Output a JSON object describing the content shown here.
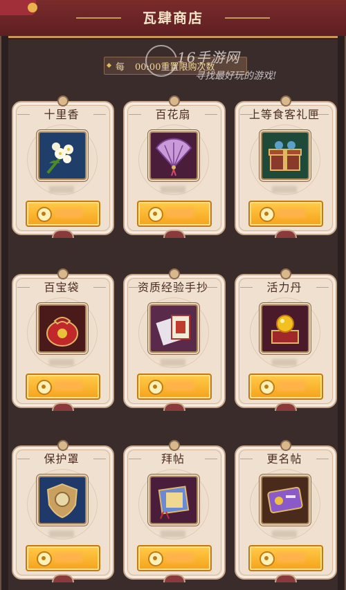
{
  "shop": {
    "title": "瓦肆商店",
    "notice_prefix": "每",
    "notice_time": "00:00重置限购次数"
  },
  "watermark": {
    "line1": "16手游网",
    "line2": "寻找最好玩的游戏!"
  },
  "items": [
    {
      "name": "十里香",
      "icon": "jasmine-flower-icon"
    },
    {
      "name": "百花扇",
      "icon": "flower-fan-icon"
    },
    {
      "name": "上等食客礼匣",
      "icon": "gift-box-icon"
    },
    {
      "name": "百宝袋",
      "icon": "treasure-bag-icon"
    },
    {
      "name": "资质经验手抄",
      "icon": "manuscript-icon"
    },
    {
      "name": "活力丹",
      "icon": "vitality-pill-icon"
    },
    {
      "name": "保护罩",
      "icon": "shield-icon"
    },
    {
      "name": "拜帖",
      "icon": "invitation-card-icon"
    },
    {
      "name": "更名帖",
      "icon": "rename-card-icon"
    }
  ],
  "colors": {
    "background": "#3b2c2c",
    "header": "#6a2427",
    "card": "#efe0cf",
    "buy_button": "#f6a21b"
  }
}
